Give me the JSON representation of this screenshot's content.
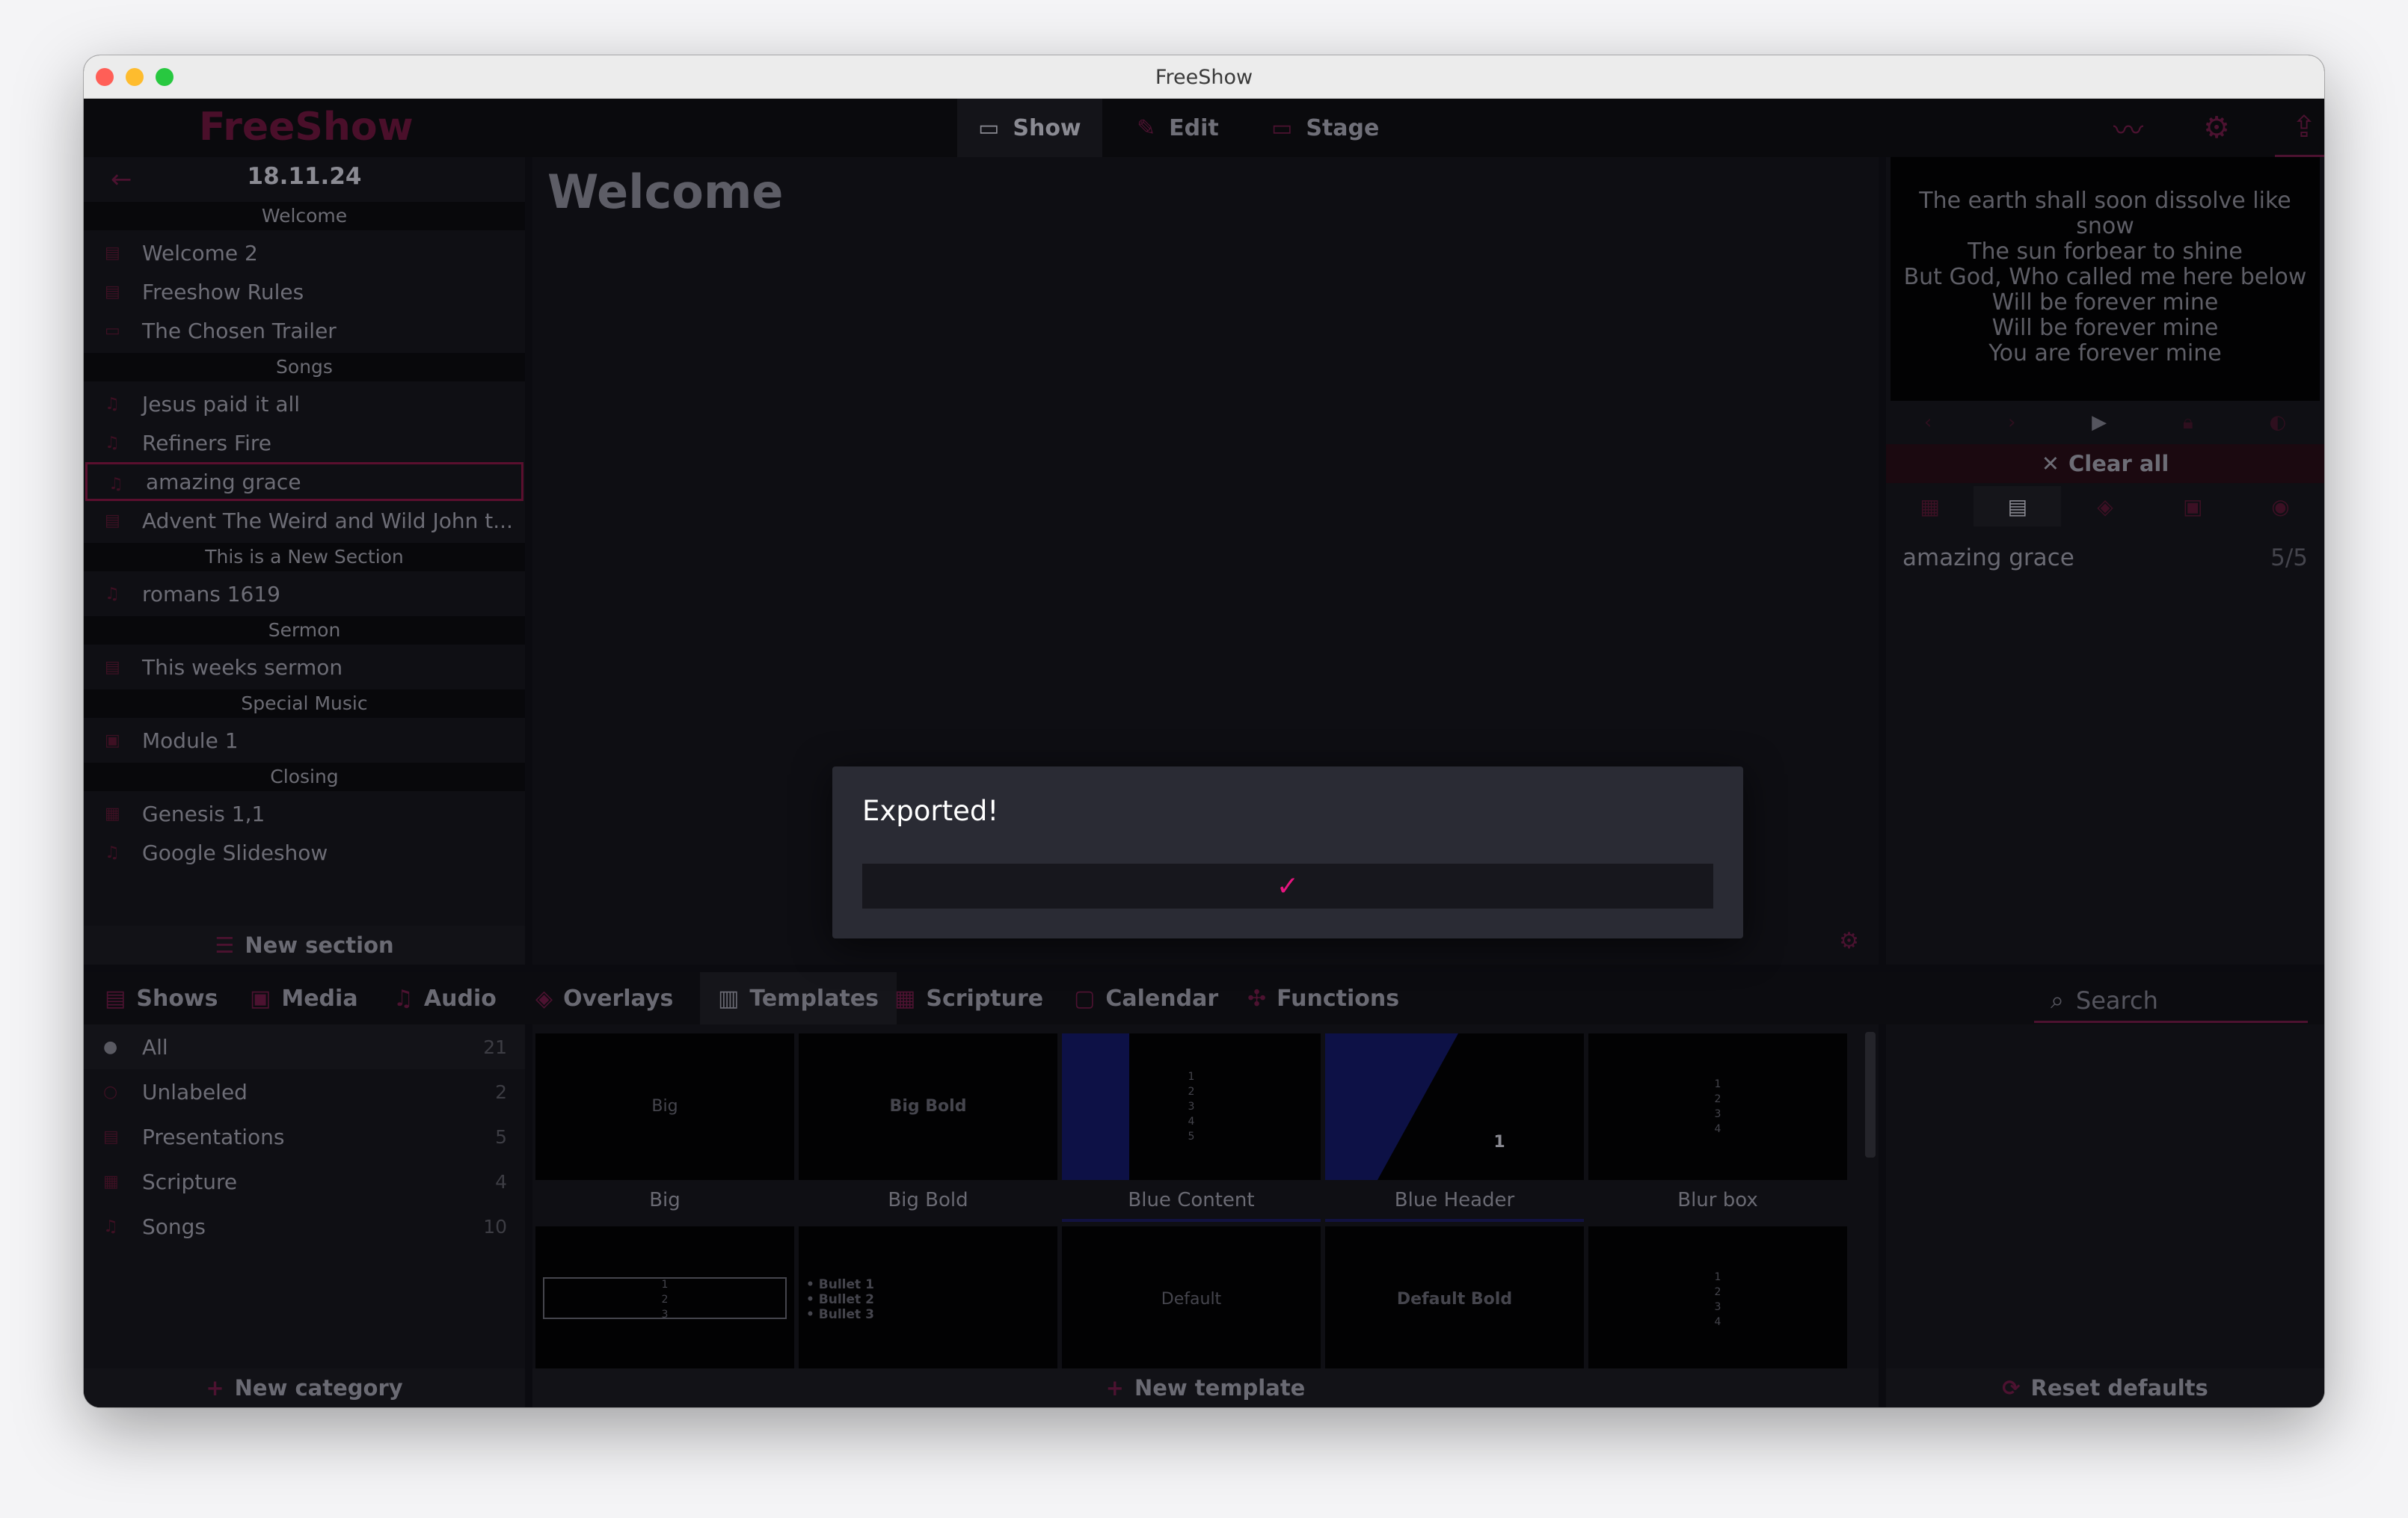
{
  "window": {
    "title": "FreeShow"
  },
  "topnav": {
    "logo": "FreeShow",
    "tabs": [
      {
        "label": "Show",
        "icon": "monitor-icon",
        "active": true
      },
      {
        "label": "Edit",
        "icon": "pencil-icon",
        "active": false
      },
      {
        "label": "Stage",
        "icon": "stage-screen-icon",
        "active": false
      }
    ],
    "right_icons": [
      "draw-icon",
      "gear-icon",
      "output-icon"
    ]
  },
  "project": {
    "date": "18.11.24",
    "sections": [
      {
        "title": "Welcome",
        "items": [
          {
            "label": "Welcome 2",
            "icon": "presentation-icon"
          },
          {
            "label": "Freeshow Rules",
            "icon": "presentation-icon"
          },
          {
            "label": "The Chosen Trailer",
            "icon": "video-icon"
          }
        ]
      },
      {
        "title": "Songs",
        "items": [
          {
            "label": "Jesus paid it all",
            "icon": "song-icon"
          },
          {
            "label": "Refiners Fire",
            "icon": "song-icon"
          },
          {
            "label": "amazing grace",
            "icon": "song-icon",
            "selected": true
          },
          {
            "label": "Advent The Weird and Wild John t...",
            "icon": "presentation-icon"
          }
        ]
      },
      {
        "title": "This is a New Section",
        "items": [
          {
            "label": "romans 1619",
            "icon": "song-icon"
          }
        ]
      },
      {
        "title": "Sermon",
        "items": [
          {
            "label": "This weeks sermon",
            "icon": "presentation-icon"
          }
        ]
      },
      {
        "title": "Special Music",
        "items": [
          {
            "label": "Module 1",
            "icon": "media-icon"
          }
        ]
      },
      {
        "title": "Closing",
        "items": [
          {
            "label": "Genesis 1,1",
            "icon": "scripture-icon"
          },
          {
            "label": "Google Slideshow",
            "icon": "song-icon"
          }
        ]
      }
    ],
    "new_section_label": "New section"
  },
  "center": {
    "title": "Welcome"
  },
  "preview": {
    "lines": [
      "The earth shall soon dissolve like",
      "snow",
      "The sun forbear to shine",
      "But God, Who called me here below",
      "Will be forever mine",
      "Will be forever mine",
      "You are forever mine"
    ],
    "clear_all_label": "Clear all",
    "current_show": "amazing grace",
    "current_count": "5/5"
  },
  "bottom_tabs": [
    {
      "label": "Shows",
      "icon": "shows-icon"
    },
    {
      "label": "Media",
      "icon": "media-icon"
    },
    {
      "label": "Audio",
      "icon": "audio-icon"
    },
    {
      "label": "Overlays",
      "icon": "overlays-icon"
    },
    {
      "label": "Templates",
      "icon": "templates-icon",
      "active": true
    },
    {
      "label": "Scripture",
      "icon": "scripture-icon"
    },
    {
      "label": "Calendar",
      "icon": "calendar-icon"
    },
    {
      "label": "Functions",
      "icon": "functions-icon"
    }
  ],
  "search": {
    "placeholder": "Search"
  },
  "categories": [
    {
      "label": "All",
      "count": "21",
      "active": true
    },
    {
      "label": "Unlabeled",
      "count": "2"
    },
    {
      "label": "Presentations",
      "count": "5"
    },
    {
      "label": "Scripture",
      "count": "4"
    },
    {
      "label": "Songs",
      "count": "10"
    }
  ],
  "new_category_label": "New category",
  "templates": [
    {
      "label": "Big",
      "preview": "Big"
    },
    {
      "label": "Big Bold",
      "preview": "Big Bold"
    },
    {
      "label": "Blue Content",
      "preview": "1\n2\n3\n4\n5"
    },
    {
      "label": "Blue Header",
      "preview": "1"
    },
    {
      "label": "Blur box",
      "preview": "1\n2\n3\n4"
    },
    {
      "label": "",
      "preview": "1\n2\n3"
    },
    {
      "label": "",
      "preview": "• Bullet 1\n• Bullet 2\n• Bullet 3"
    },
    {
      "label": "",
      "preview": "Default"
    },
    {
      "label": "",
      "preview": "Default Bold"
    },
    {
      "label": "",
      "preview": "1\n2\n3\n4"
    }
  ],
  "new_template_label": "New template",
  "reset_defaults_label": "Reset defaults",
  "modal": {
    "title": "Exported!",
    "check_icon": "checkmark-icon"
  },
  "colors": {
    "accent": "#e6157f",
    "dim_accent": "#4c1230",
    "background": "#0b0b10"
  }
}
